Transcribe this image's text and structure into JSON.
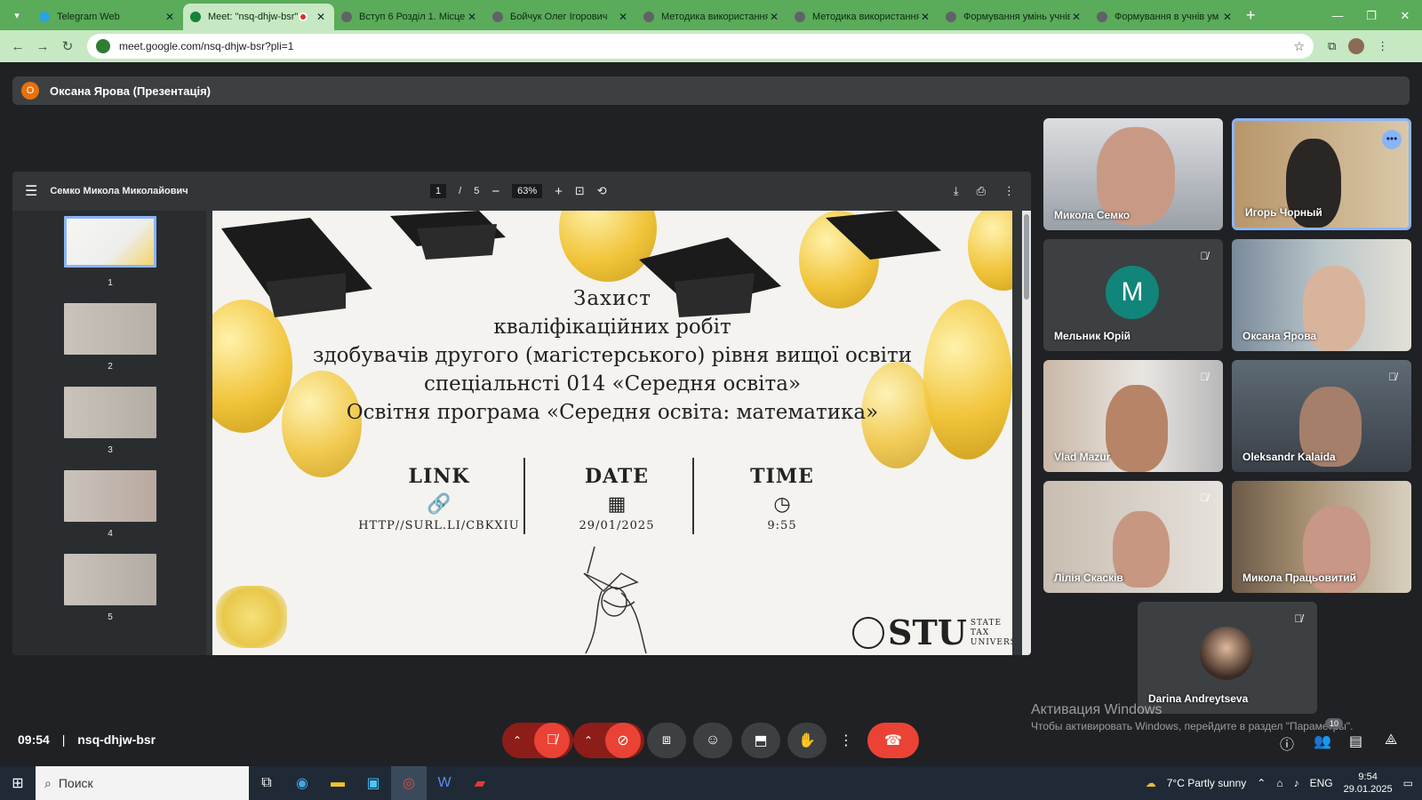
{
  "browser": {
    "tabs": [
      {
        "title": "Telegram Web",
        "color": "#2aa3e0"
      },
      {
        "title": "Meet: \"nsq-dhjw-bsr\"",
        "color": "#188038"
      },
      {
        "title": "Вступ 6 Розділ 1. Місце і",
        "color": "#5f6368"
      },
      {
        "title": "Бойчук Олег Ігорович",
        "color": "#5f6368"
      },
      {
        "title": "Методика використання",
        "color": "#5f6368"
      },
      {
        "title": "Методика використання",
        "color": "#5f6368"
      },
      {
        "title": "Формування умінь учнів",
        "color": "#5f6368"
      },
      {
        "title": "Формування в учнів ум",
        "color": "#5f6368"
      }
    ],
    "url": "meet.google.com/nsq-dhjw-bsr?pli=1"
  },
  "meet": {
    "presenter_initial": "О",
    "presenter_label": "Оксана Ярова (Презентація)",
    "pdf": {
      "doc_name": "Семко Микола Миколайович",
      "page_current": "1",
      "page_sep": "/",
      "page_total": "5",
      "zoom": "63%",
      "thumb_nums": [
        "1",
        "2",
        "3",
        "4",
        "5"
      ]
    },
    "slide": {
      "line1": "Захист",
      "line2": "кваліфікаційних робіт",
      "line3": "здобувачів другого (магістерського) рівня вищої освіти",
      "line4": "спеціальнсті 014 «Середня освіта»",
      "line5": "Освітня програма «Середня освіта: математика»",
      "link_head": "LINK",
      "link_val": "HTTP//SURL.LI/CBKXIU",
      "date_head": "DATE",
      "date_val": "29/01/2025",
      "time_head": "TIME",
      "time_val": "9:55",
      "stu_big": "STU",
      "stu_small1": "STATE",
      "stu_small2": "TAX",
      "stu_small3": "UNIVERSITY"
    },
    "participants": [
      {
        "name": "Микола Семко",
        "muted": false
      },
      {
        "name": "Игорь Чорный",
        "muted": false,
        "more": "•••"
      },
      {
        "name": "Мельник Юрій",
        "muted": true,
        "initial": "M"
      },
      {
        "name": "Оксана Ярова",
        "muted": false
      },
      {
        "name": "Vlad Mazur",
        "muted": true
      },
      {
        "name": "Oleksandr Kalaida",
        "muted": true
      },
      {
        "name": "Лілія Скасків",
        "muted": true
      },
      {
        "name": "Микола Працьовитий",
        "muted": false
      },
      {
        "name": "Darina Andreytseva",
        "muted": true
      }
    ],
    "time": "09:54",
    "separator": "|",
    "meeting_code": "nsq-dhjw-bsr",
    "people_count": "10",
    "watermark_title": "Активация Windows",
    "watermark_sub": "Чтобы активировать Windows, перейдите в раздел \"Параметры\"."
  },
  "taskbar": {
    "search_label": "Поиск",
    "weather": "7°C  Partly sunny",
    "lang": "ENG",
    "clock_time": "9:54",
    "clock_date": "29.01.2025"
  },
  "colors": {
    "chrome_green": "#5aab5a",
    "meet_bg": "#202124",
    "end_call": "#ea4335",
    "active_tile_border": "#8ab4f8"
  }
}
